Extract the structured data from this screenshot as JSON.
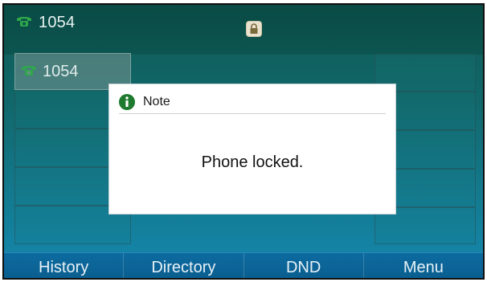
{
  "status": {
    "line_label": "1054",
    "lock_icon": "lock-icon"
  },
  "line_key": {
    "label": "1054",
    "icon": "phone-handset-icon"
  },
  "dialog": {
    "title": "Note",
    "message": "Phone locked.",
    "icon": "info-icon"
  },
  "softkeys": [
    {
      "label": "History"
    },
    {
      "label": "Directory"
    },
    {
      "label": "DND"
    },
    {
      "label": "Menu"
    }
  ],
  "colors": {
    "phone_icon": "#2ea84a",
    "info_icon": "#1d7a2e",
    "softkey_bar": "#0b63a0"
  }
}
